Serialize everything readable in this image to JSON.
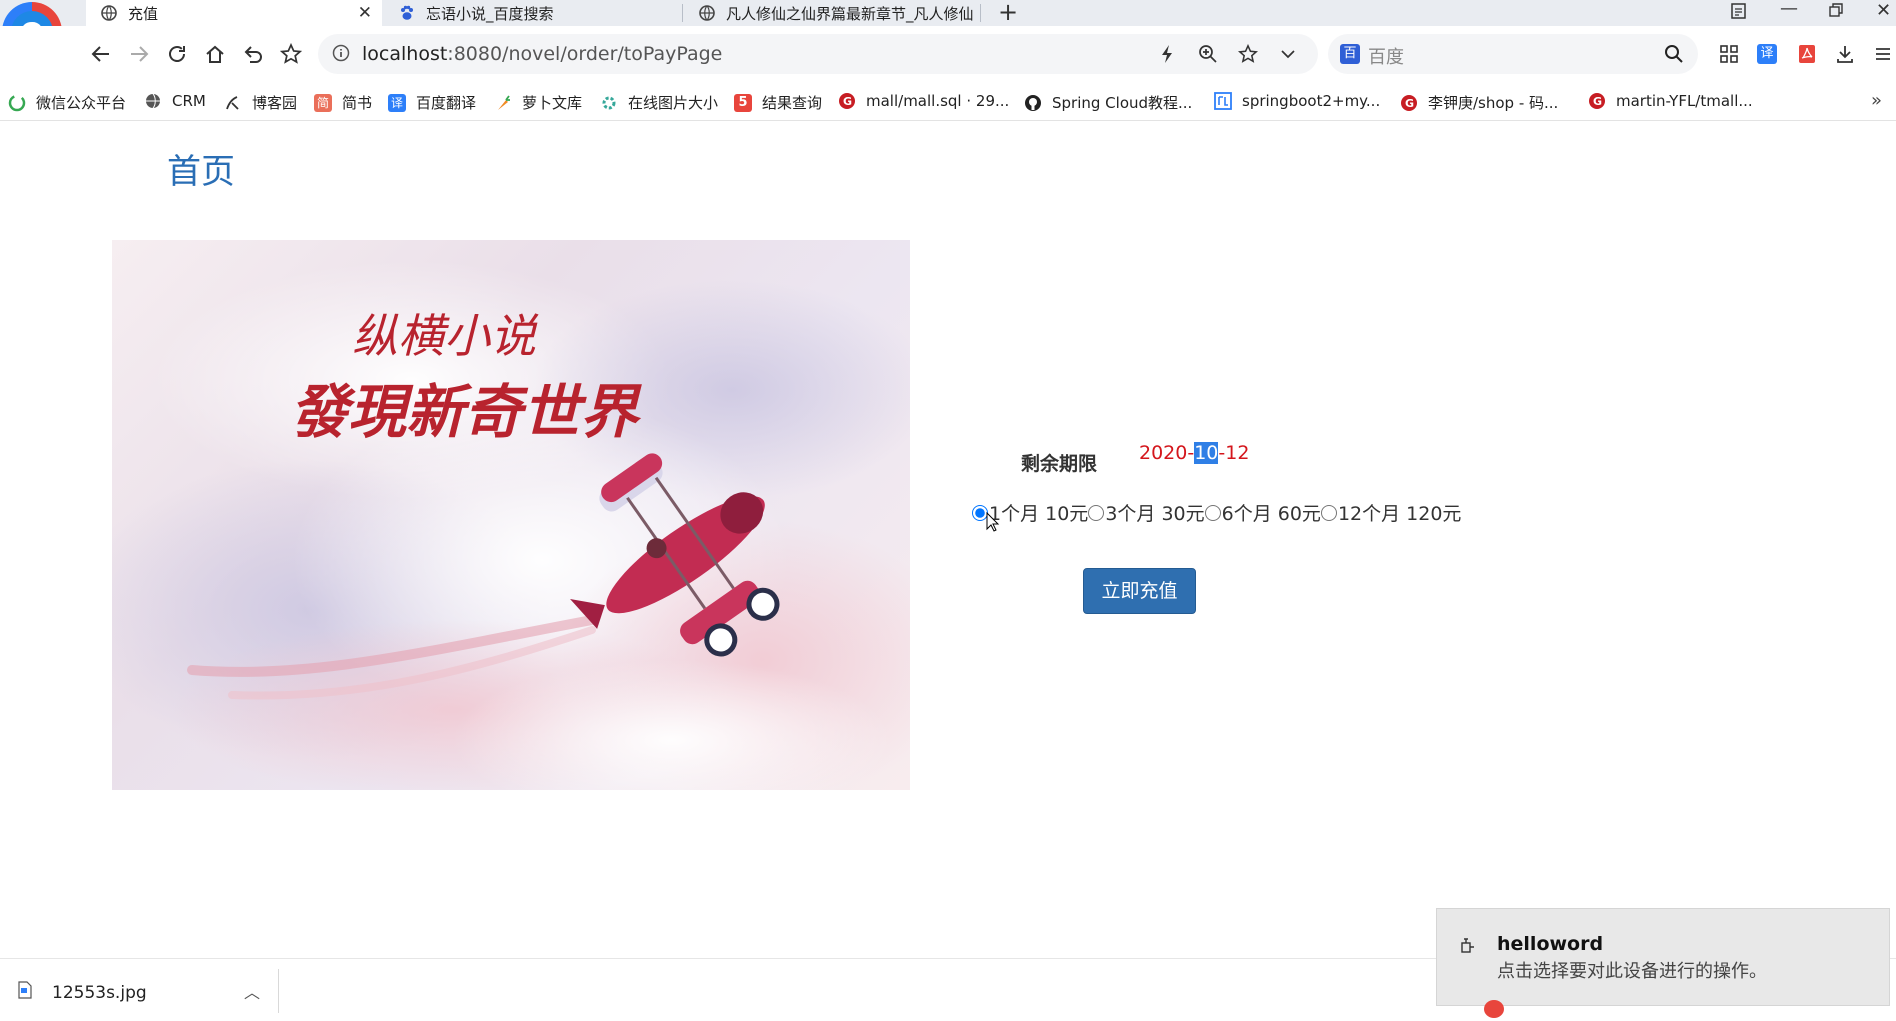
{
  "tabs": [
    {
      "title": "充值",
      "active": true
    },
    {
      "title": "忘语小说_百度搜索",
      "active": false
    },
    {
      "title": "凡人修仙之仙界篇最新章节_凡人修仙",
      "active": false
    }
  ],
  "address": {
    "host": "localhost",
    "rest": ":8080/novel/order/toPayPage"
  },
  "search": {
    "placeholder": "百度"
  },
  "bookmarks": [
    "微信公众平台",
    "CRM",
    "博客园",
    "简书",
    "百度翻译",
    "萝卜文库",
    "在线图片大小",
    "结果查询",
    "mall/mall.sql · 29...",
    "Spring Cloud教程...",
    "springboot2+my...",
    "李钾庚/shop - 码...",
    "martin-YFL/tmall..."
  ],
  "page": {
    "title": "首页",
    "banner": {
      "line1": "纵横小说",
      "line2": "發現新奇世界"
    },
    "remain_label": "剩余期限",
    "remain_date": {
      "part1": "2020-",
      "highlight": "10",
      "part2": "-12"
    },
    "options": [
      {
        "label": "1个月 10元",
        "checked": true
      },
      {
        "label": "3个月 30元",
        "checked": false
      },
      {
        "label": "6个月 60元",
        "checked": false
      },
      {
        "label": "12个月 120元",
        "checked": false
      }
    ],
    "pay_button": "立即充值"
  },
  "download": {
    "filename": "12553s.jpg"
  },
  "toast": {
    "title": "helloword",
    "body": "点击选择要对此设备进行的操作。"
  },
  "colors": {
    "link": "#2a6eb5",
    "date": "#d4161c",
    "button": "#2f6fb0",
    "highlight": "#2f7fe6"
  }
}
